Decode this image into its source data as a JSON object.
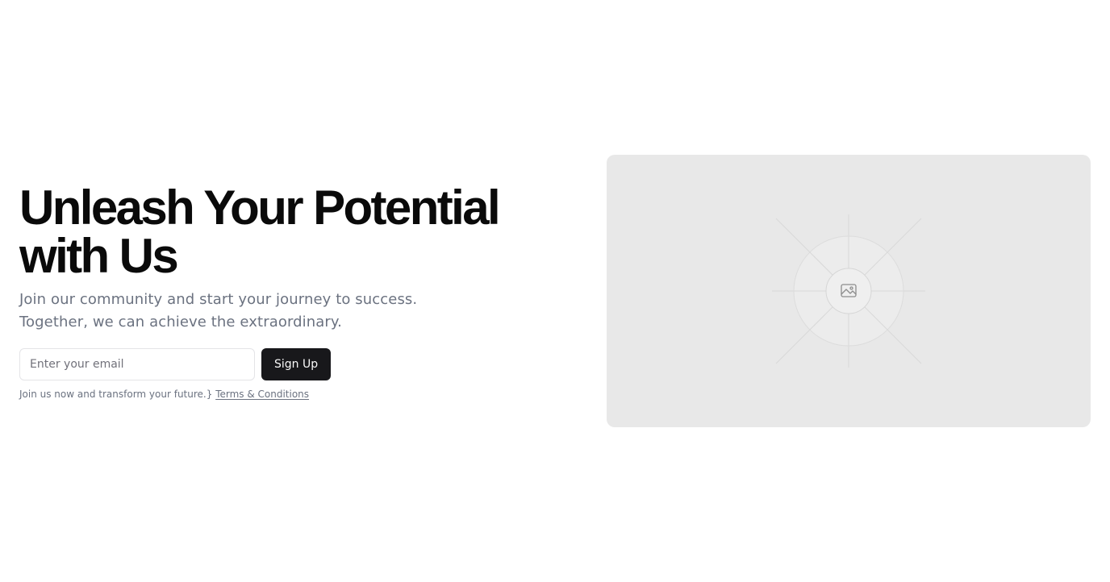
{
  "hero": {
    "headline": "Unleash Your Potential with Us",
    "subtext": "Join our community and start your journey to success. Together, we can achieve the extraordinary.",
    "email_placeholder": "Enter your email",
    "signup_label": "Sign Up",
    "note_text": "Join us now and transform your future.}",
    "terms_link": "Terms & Conditions"
  },
  "media": {
    "icon": "image-placeholder-icon",
    "background": "#e8e8e8"
  },
  "colors": {
    "button_bg": "#18181b",
    "muted_text": "#6b7280"
  }
}
